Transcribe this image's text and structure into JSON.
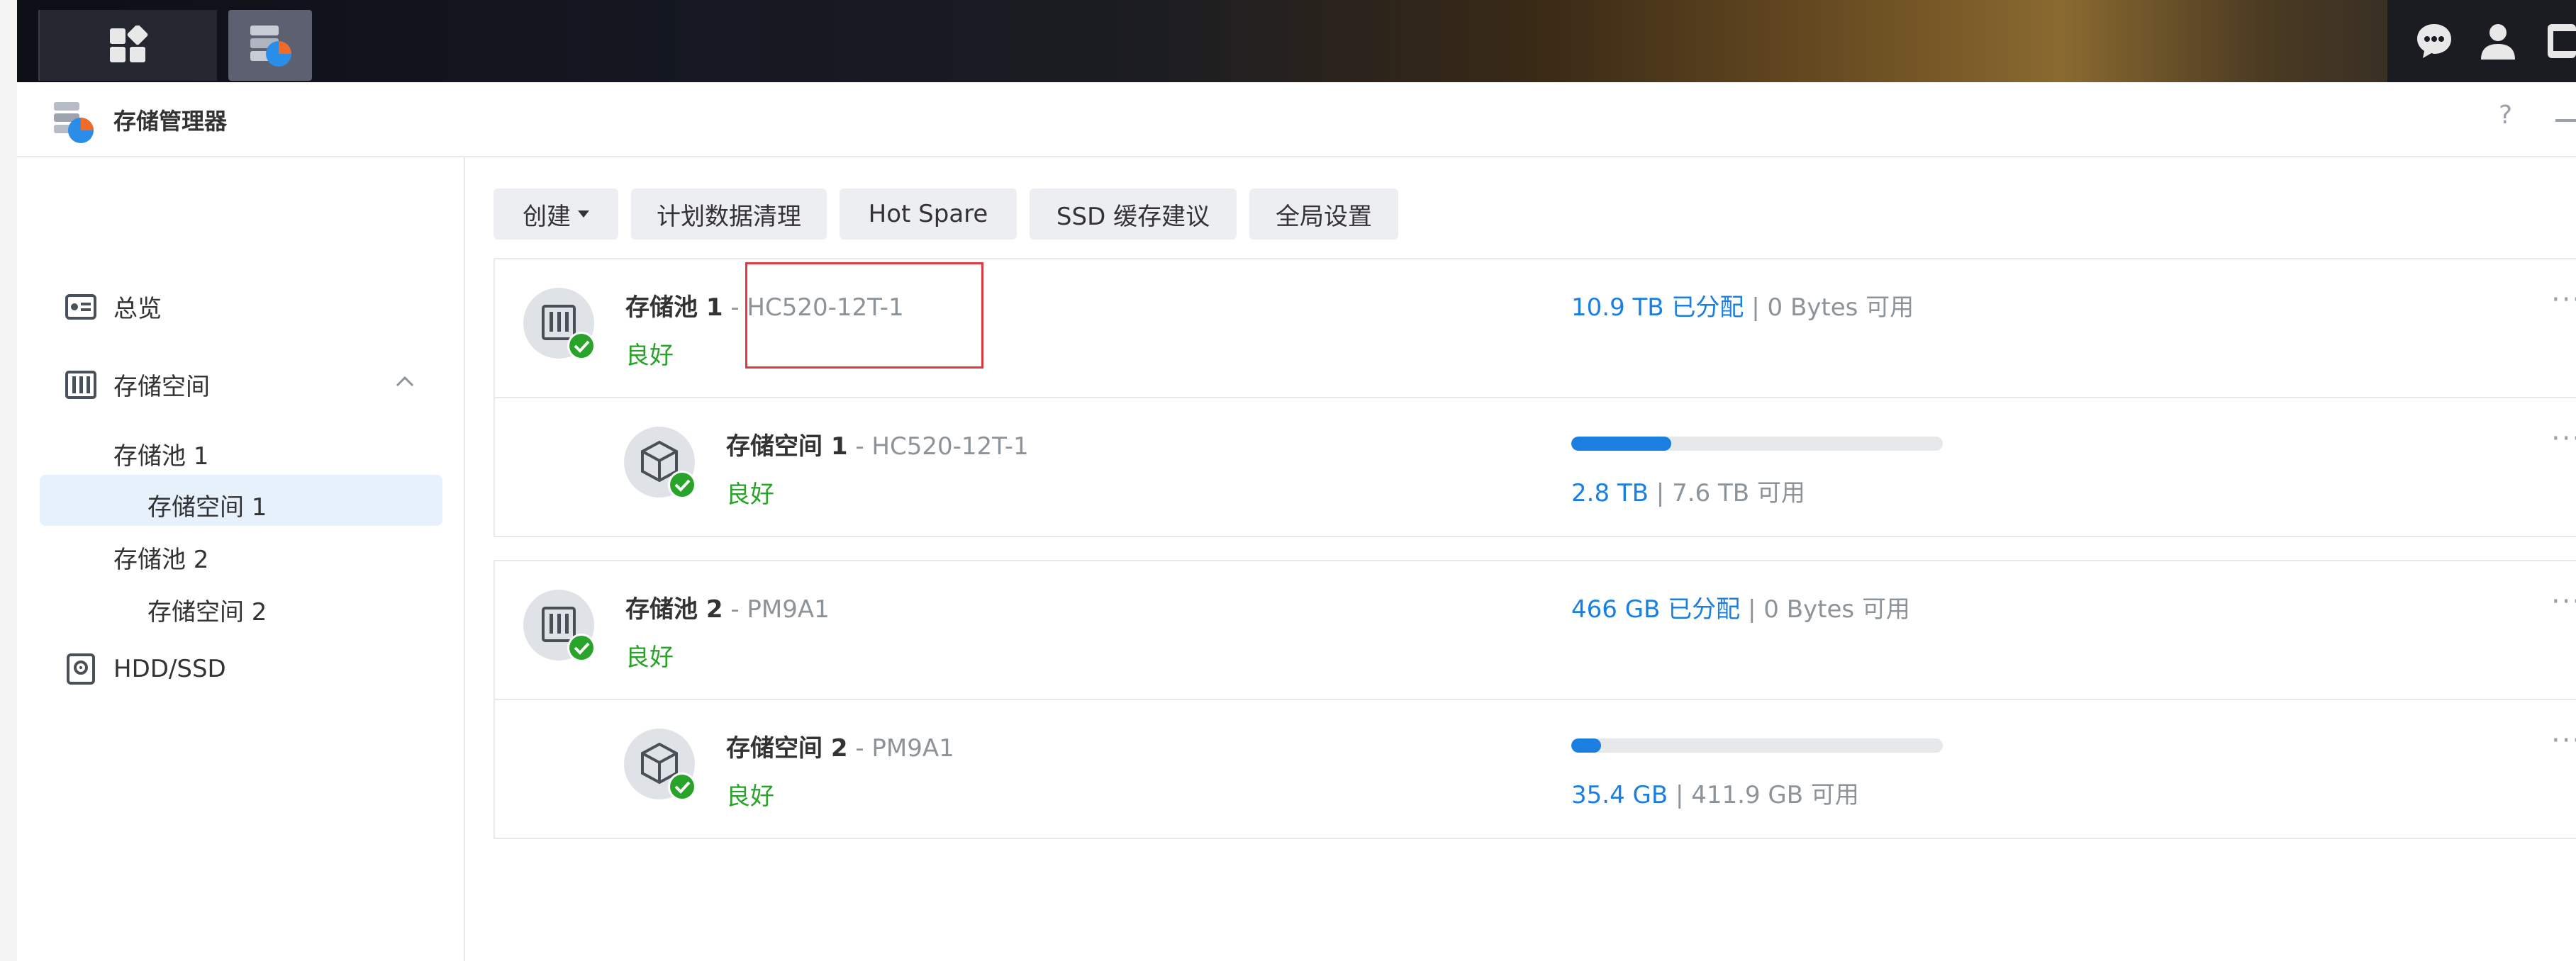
{
  "taskbar": {
    "main_menu_icon": "grid-icon",
    "storage_app_icon": "storage-manager-icon",
    "chat_icon": "chat-bubble-icon",
    "user_icon": "user-icon"
  },
  "window": {
    "title": "存储管理器",
    "help": "?"
  },
  "sidebar": {
    "overview": "总览",
    "storage": "存储空间",
    "pool1": "存储池 1",
    "volume1": "存储空间 1",
    "pool2": "存储池 2",
    "volume2": "存储空间 2",
    "hdd": "HDD/SSD"
  },
  "toolbar": {
    "create": "创建",
    "scrub": "计划数据清理",
    "hot_spare": "Hot Spare",
    "ssd_cache": "SSD 缓存建议",
    "global_settings": "全局设置"
  },
  "pools": [
    {
      "name": "存储池 1",
      "separator": "-",
      "model": "HC520-12T-1",
      "status": "良好",
      "allocated": "10.9 TB 已分配",
      "divider": "|",
      "available": "0 Bytes 可用",
      "volume": {
        "name": "存储空间 1",
        "separator": "-",
        "model": "HC520-12T-1",
        "status": "良好",
        "used": "2.8 TB",
        "divider": "|",
        "available": "7.6 TB 可用",
        "usage_fraction": 0.27
      }
    },
    {
      "name": "存储池 2",
      "separator": "-",
      "model": "PM9A1",
      "status": "良好",
      "allocated": "466 GB 已分配",
      "divider": "|",
      "available": "0 Bytes 可用",
      "volume": {
        "name": "存储空间 2",
        "separator": "-",
        "model": "PM9A1",
        "status": "良好",
        "used": "35.4 GB",
        "divider": "|",
        "available": "411.9 GB 可用",
        "usage_fraction": 0.08
      }
    }
  ],
  "more_label": "···",
  "colors": {
    "accent": "#1a7fe0",
    "status_good": "#29a329",
    "highlight": "#e0393e"
  }
}
